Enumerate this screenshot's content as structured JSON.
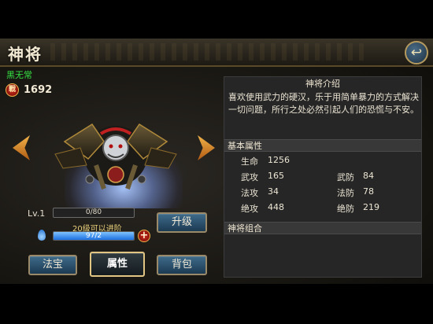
{
  "header": {
    "title": "神将",
    "back_icon": "back-arrow-icon"
  },
  "hero": {
    "name": "黑无常",
    "power_badge": "戰",
    "power": "1692"
  },
  "progress": {
    "level_label": "Lv.1",
    "exp_text": "0/80",
    "advance_note": "20级可以进阶",
    "mana_text": "97/2",
    "mana_fill": 1.0
  },
  "buttons": {
    "upgrade": "升级",
    "treasure": "法宝",
    "attributes": "属性",
    "bag": "背包",
    "plus": "+"
  },
  "info": {
    "intro_title": "神将介绍",
    "intro_text": "喜欢使用武力的硬汉，乐于用简单暴力的方式解决一切问题，所行之处必然引起人们的恐慌与不安。",
    "basic_title": "基本属性",
    "combo_title": "神将组合",
    "stats": {
      "hp_label": "生命",
      "hp": "1256",
      "patk_label": "武攻",
      "patk": "165",
      "pdef_label": "武防",
      "pdef": "84",
      "matk_label": "法攻",
      "matk": "34",
      "mdef_label": "法防",
      "mdef": "78",
      "uatk_label": "绝攻",
      "uatk": "448",
      "udef_label": "绝防",
      "udef": "219"
    }
  },
  "colors": {
    "name_green": "#35e043",
    "accent_gold": "#e0c583",
    "button_blue": "#3e6b8a"
  }
}
